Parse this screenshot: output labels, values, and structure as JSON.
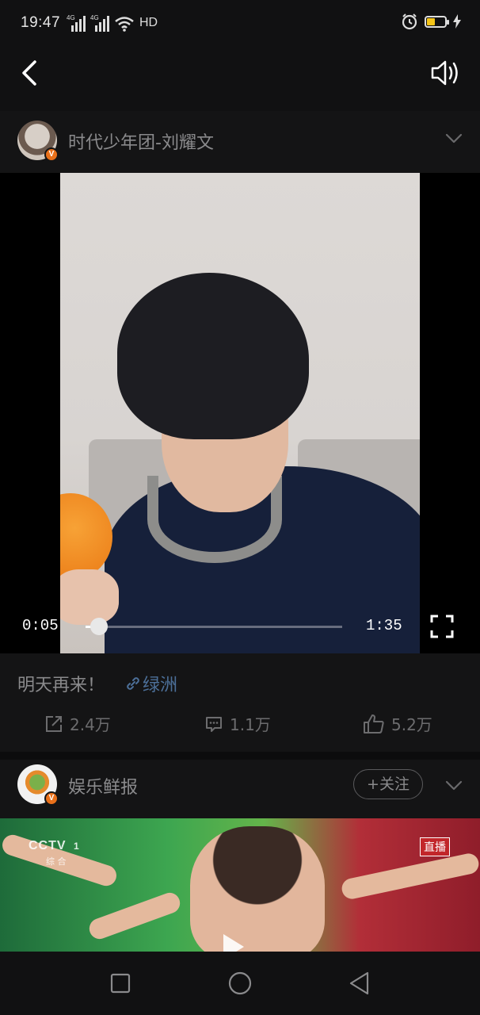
{
  "status_bar": {
    "time": "19:47",
    "signal1_label": "4G",
    "signal2_label": "4G",
    "hd_label": "HD",
    "battery_color": "#f5c518"
  },
  "topbar": {
    "back_icon": "chevron-left-icon",
    "sound_icon": "speaker-icon"
  },
  "post": {
    "author": "时代少年团-刘耀文",
    "verified_badge": "V",
    "video": {
      "current_time": "0:05",
      "duration": "1:35",
      "progress_fraction": 0.053
    },
    "caption": "明天再来！",
    "topic": "绿洲",
    "actions": [
      {
        "icon": "share-icon",
        "count": "2.4万"
      },
      {
        "icon": "comment-icon",
        "count": "1.1万"
      },
      {
        "icon": "like-icon",
        "count": "5.2万"
      }
    ]
  },
  "next_post": {
    "author": "娱乐鲜报",
    "verified_badge": "V",
    "follow_label": "+关注",
    "channel_logo": "CCTV",
    "channel_number": "1",
    "channel_sub": "综 合",
    "live_label": "直播"
  },
  "navbar": {
    "items": [
      "square-icon",
      "circle-icon",
      "triangle-back-icon"
    ]
  }
}
